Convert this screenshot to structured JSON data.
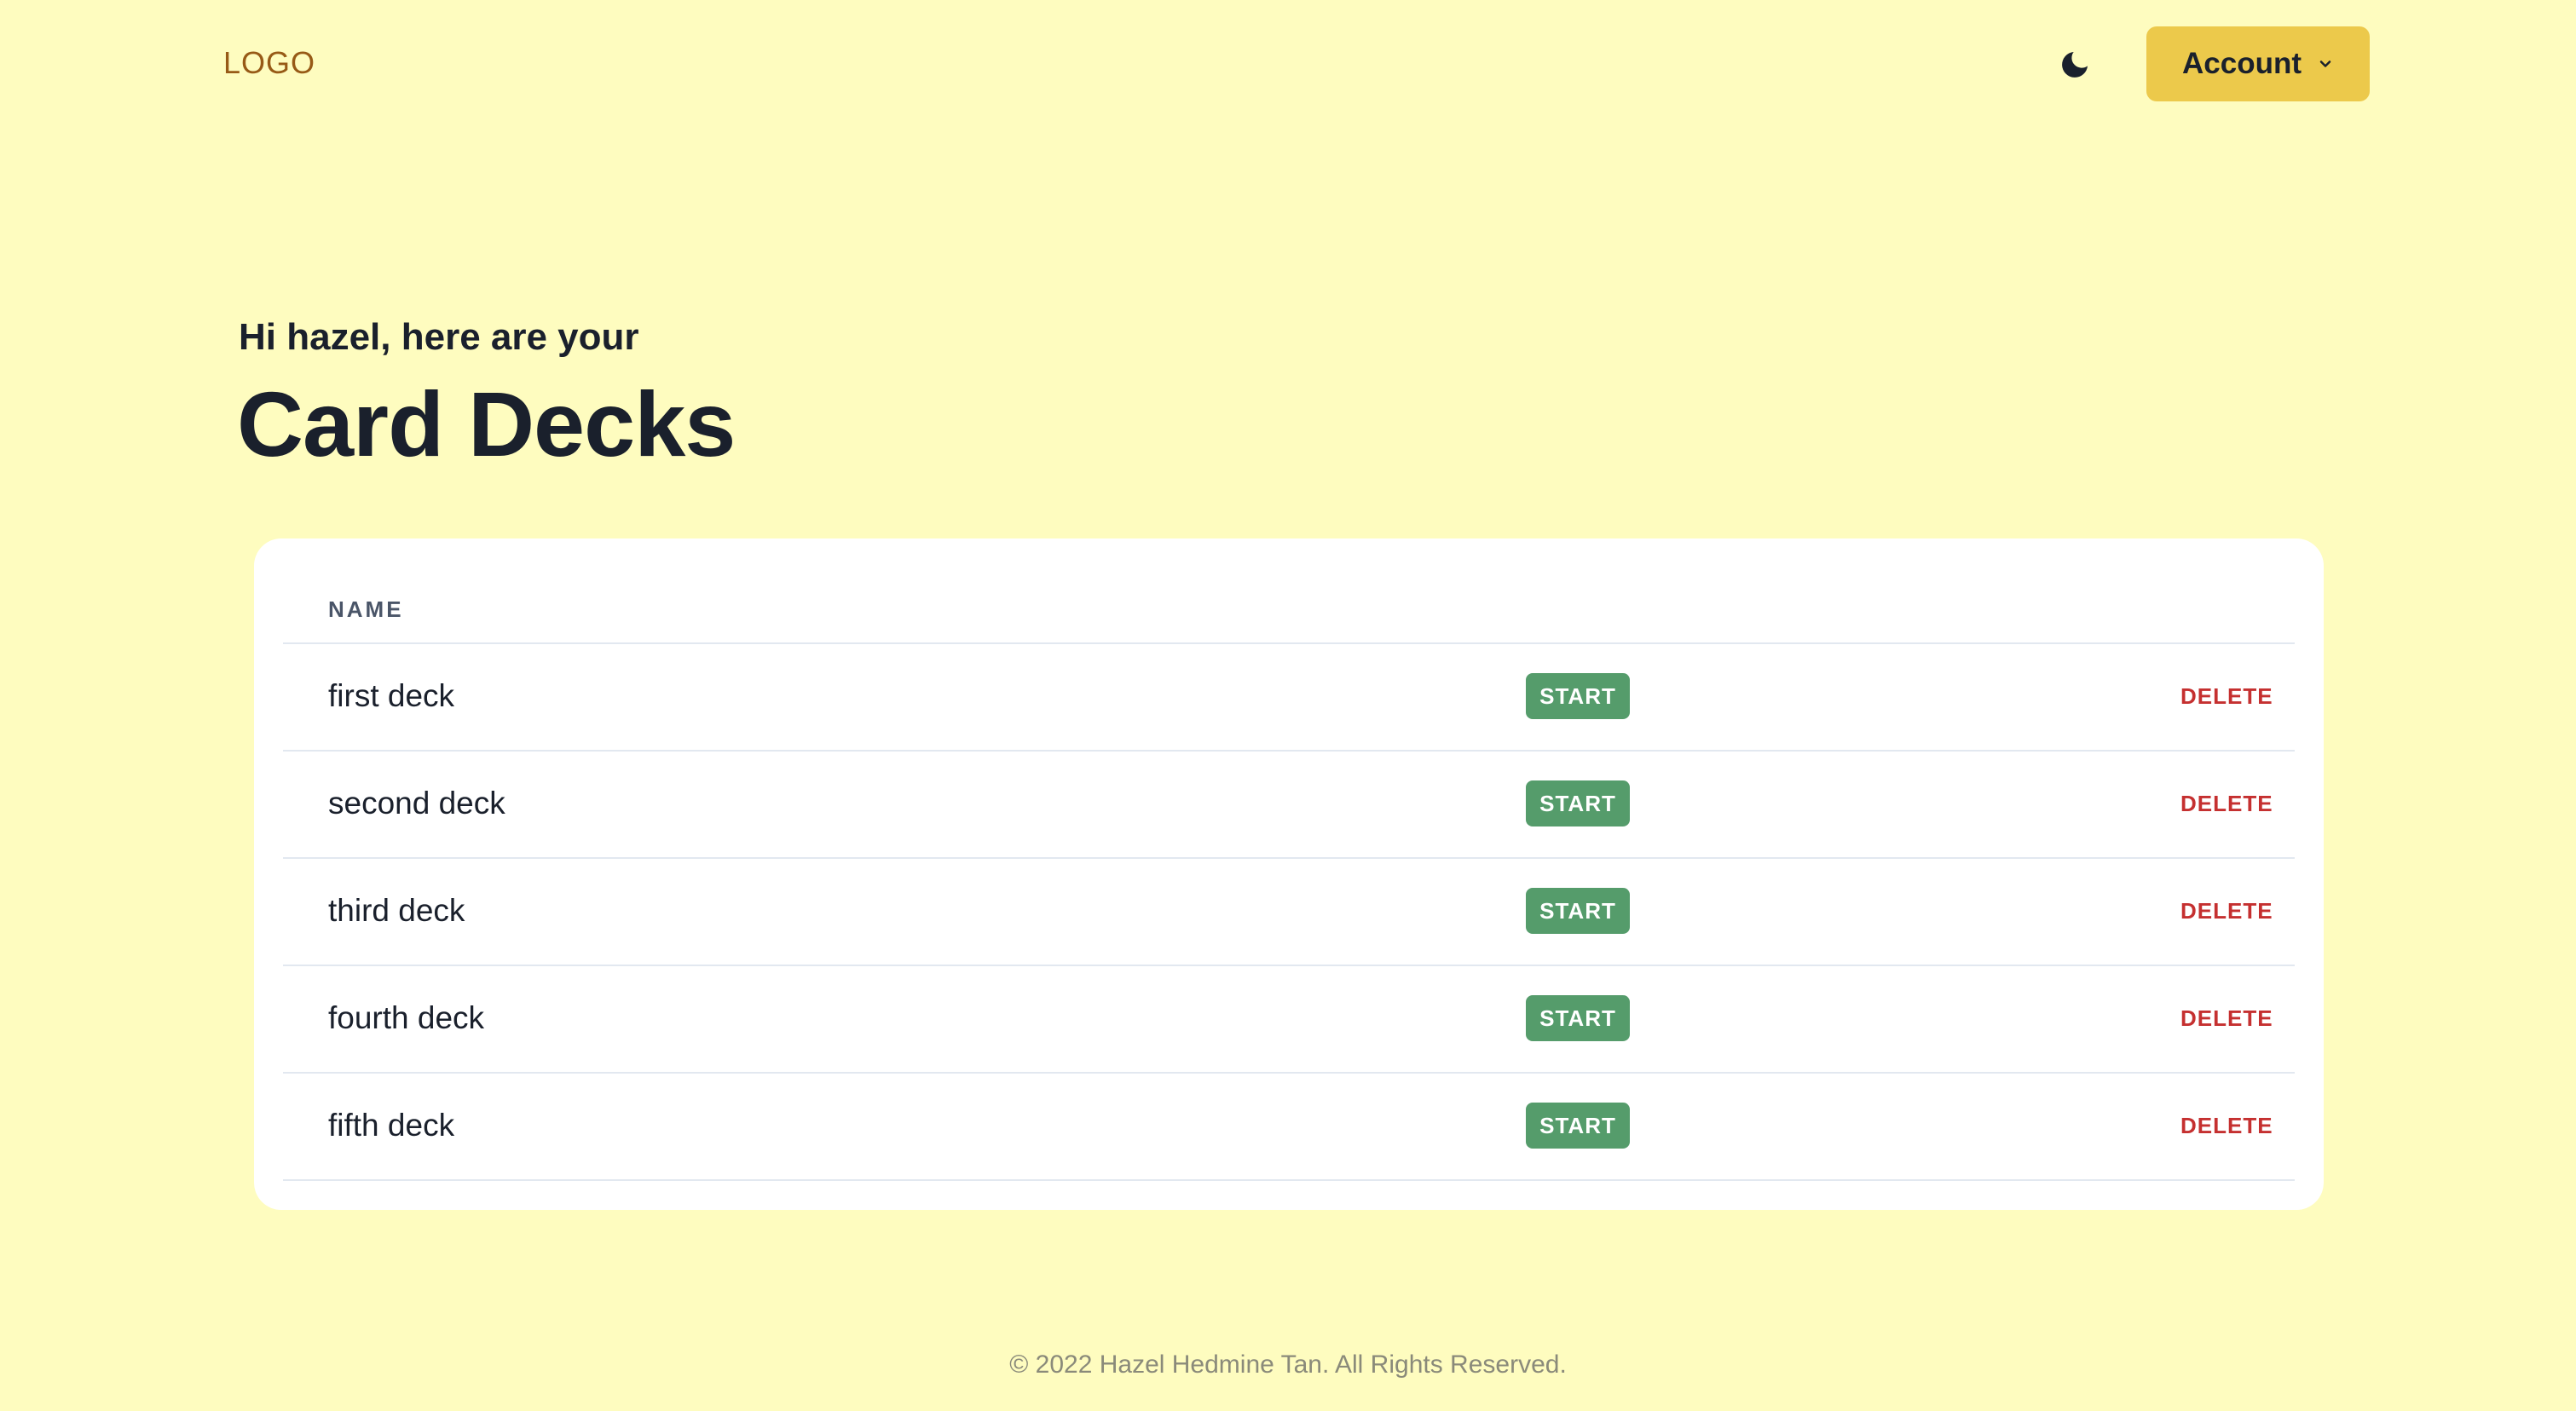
{
  "header": {
    "logo": "LOGO",
    "theme_icon": "moon-icon",
    "account_label": "Account",
    "account_icon": "chevron-down-icon"
  },
  "main": {
    "greeting": "Hi hazel, here are your",
    "title": "Card Decks"
  },
  "table": {
    "column_name": "NAME",
    "rows": [
      {
        "name": "first deck",
        "start": "START",
        "delete": "DELETE"
      },
      {
        "name": "second deck",
        "start": "START",
        "delete": "DELETE"
      },
      {
        "name": "third deck",
        "start": "START",
        "delete": "DELETE"
      },
      {
        "name": "fourth deck",
        "start": "START",
        "delete": "DELETE"
      },
      {
        "name": "fifth deck",
        "start": "START",
        "delete": "DELETE"
      }
    ]
  },
  "footer": {
    "text": "© 2022 Hazel Hedmine Tan. All Rights Reserved."
  },
  "colors": {
    "background": "#fefcbf",
    "account_button": "#ecc94b",
    "start_button": "#559c6b",
    "delete_text": "#c53030",
    "logo": "#975a16"
  }
}
